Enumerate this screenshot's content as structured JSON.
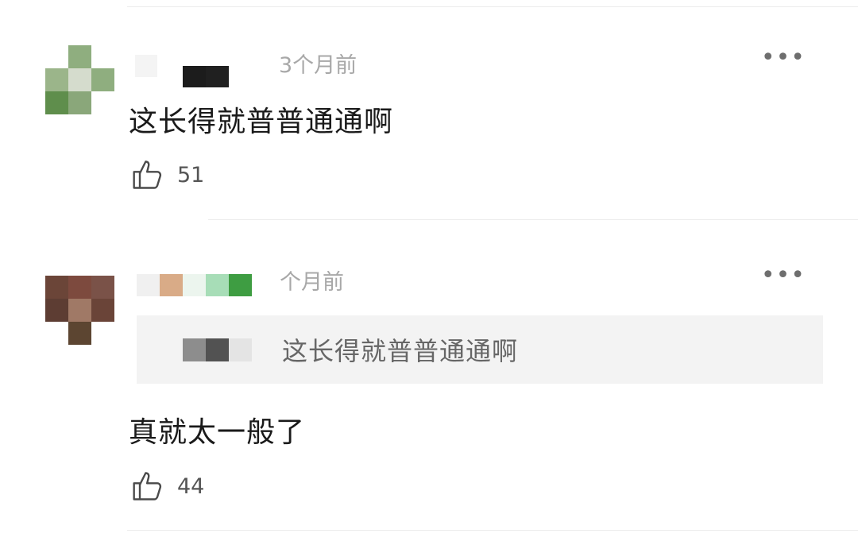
{
  "comments": [
    {
      "time": "3个月前",
      "text": "这长得就普普通通啊",
      "likes": "51",
      "more_icon": "more-dots-icon"
    },
    {
      "time": "个月前",
      "text": "真就太一般了",
      "likes": "44",
      "more_icon": "more-dots-icon",
      "reply_to": {
        "text": "这长得就普普通通啊"
      }
    }
  ],
  "colors": {
    "text": "#1a1a1a",
    "muted": "#a8a8a8",
    "quote_bg": "#f3f3f3"
  }
}
